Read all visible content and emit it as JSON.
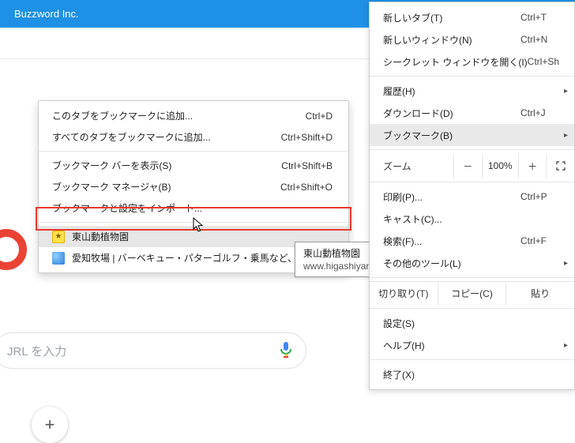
{
  "titlebar": {
    "title": "Buzzword Inc."
  },
  "searchbar": {
    "placeholder": "JRL を入力"
  },
  "chrome_menu": {
    "new_tab": {
      "label": "新しいタブ(T)",
      "accel": "Ctrl+T"
    },
    "new_window": {
      "label": "新しいウィンドウ(N)",
      "accel": "Ctrl+N"
    },
    "incognito": {
      "label": "シークレット ウィンドウを開く(I)",
      "accel": "Ctrl+Sh"
    },
    "history": {
      "label": "履歴(H)"
    },
    "downloads": {
      "label": "ダウンロード(D)",
      "accel": "Ctrl+J"
    },
    "bookmarks": {
      "label": "ブックマーク(B)"
    },
    "zoom": {
      "label": "ズーム",
      "minus": "－",
      "pct": "100%",
      "plus": "＋"
    },
    "print": {
      "label": "印刷(P)...",
      "accel": "Ctrl+P"
    },
    "cast": {
      "label": "キャスト(C)..."
    },
    "find": {
      "label": "検索(F)...",
      "accel": "Ctrl+F"
    },
    "more_tools": {
      "label": "その他のツール(L)"
    },
    "edit_row": {
      "cut": "切り取り(T)",
      "copy": "コピー(C)",
      "paste": "貼り"
    },
    "settings": {
      "label": "設定(S)"
    },
    "help": {
      "label": "ヘルプ(H)"
    },
    "exit": {
      "label": "終了(X)"
    }
  },
  "bookmarks_menu": {
    "add_current": {
      "label": "このタブをブックマークに追加...",
      "accel": "Ctrl+D"
    },
    "add_all": {
      "label": "すべてのタブをブックマークに追加...",
      "accel": "Ctrl+Shift+D"
    },
    "show_bar": {
      "label": "ブックマーク バーを表示(S)",
      "accel": "Ctrl+Shift+B"
    },
    "manager": {
      "label": "ブックマーク マネージャ(B)",
      "accel": "Ctrl+Shift+O"
    },
    "import": {
      "label": "ブックマークと設定をインポート..."
    },
    "bookmark1": {
      "label": "東山動植物園"
    },
    "bookmark2": {
      "label": "愛知牧場 | バーベキュー・パターゴルフ・乗馬など、名古…"
    }
  },
  "tooltip": {
    "title": "東山動植物園",
    "url": "www.higashiyama.city.nagoya.jp"
  },
  "fab": {
    "glyph": "+"
  }
}
